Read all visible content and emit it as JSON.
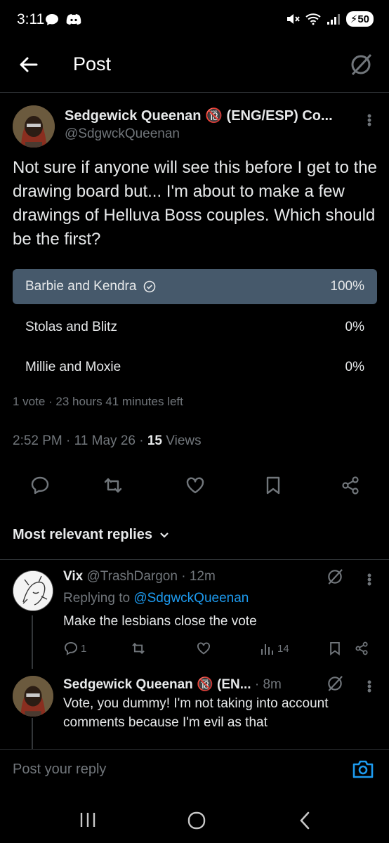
{
  "status_bar": {
    "time": "3:11",
    "battery": "50"
  },
  "header": {
    "title": "Post"
  },
  "post": {
    "author_name": "Sedgewick Queenan 🔞 (ENG/ESP) Co...",
    "author_handle": "@SdgwckQueenan",
    "text": "Not sure if anyone will see this before I get to the drawing board but... I'm about to make a few drawings of Helluva Boss couples. Which should be the first?",
    "poll": {
      "options": [
        {
          "label": "Barbie and Kendra",
          "percent": "100%",
          "winner": true
        },
        {
          "label": "Stolas and Blitz",
          "percent": "0%",
          "winner": false
        },
        {
          "label": "Millie and Moxie",
          "percent": "0%",
          "winner": false
        }
      ],
      "meta": "1 vote · 23 hours 41 minutes left"
    },
    "timestamp": "2:52 PM · 11 May 26 · ",
    "views_count": "15",
    "views_label": " Views"
  },
  "sort": {
    "label": "Most relevant replies"
  },
  "replies": [
    {
      "name": "Vix",
      "handle_time": " @TrashDargon · 12m",
      "replying_prefix": "Replying to ",
      "replying_handle": "@SdgwckQueenan",
      "text": "Make the lesbians close the vote",
      "reply_count": "1",
      "views": "14"
    },
    {
      "name": "Sedgewick Queenan 🔞 (EN...",
      "handle_time": " · 8m",
      "text": "Vote, you dummy! I'm not taking into account comments because I'm evil as that"
    }
  ],
  "reply_input": {
    "placeholder": "Post your reply"
  },
  "colors": {
    "accent": "#1d9bf0",
    "poll_winner": "#46596b",
    "background": "#000000",
    "muted": "#71767b"
  }
}
